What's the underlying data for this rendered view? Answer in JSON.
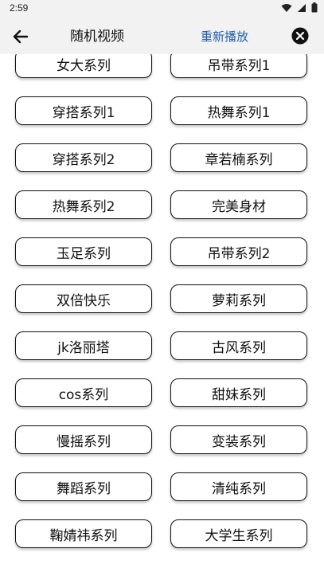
{
  "status_bar": {
    "time": "2:59",
    "icons": [
      "wifi-icon",
      "signal-icon",
      "battery-icon"
    ]
  },
  "header": {
    "title": "随机视频",
    "replay_label": "重新播放",
    "back_icon": "arrow-left-icon",
    "close_icon": "close-circle-icon",
    "accent_color": "#245da6"
  },
  "categories": [
    [
      "女大系列",
      "吊带系列1"
    ],
    [
      "穿搭系列1",
      "热舞系列1"
    ],
    [
      "穿搭系列2",
      "章若楠系列"
    ],
    [
      "热舞系列2",
      "完美身材"
    ],
    [
      "玉足系列",
      "吊带系列2"
    ],
    [
      "双倍快乐",
      "萝莉系列"
    ],
    [
      "jk洛丽塔",
      "古风系列"
    ],
    [
      "cos系列",
      "甜妹系列"
    ],
    [
      "慢摇系列",
      "变装系列"
    ],
    [
      "舞蹈系列",
      "清纯系列"
    ],
    [
      "鞠婧祎系列",
      "大学生系列"
    ]
  ]
}
